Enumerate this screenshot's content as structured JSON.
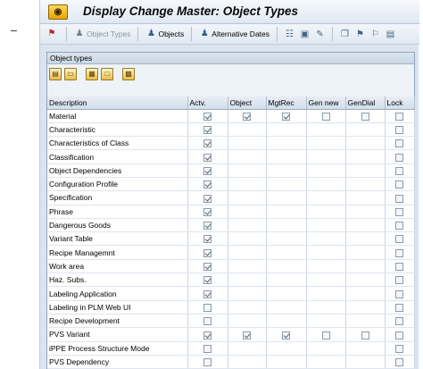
{
  "window": {
    "title": "Display Change Master: Object Types",
    "app_icon": "glasses-icon"
  },
  "toolbar": {
    "object_types_label": "Object Types",
    "objects_label": "Objects",
    "alternative_dates_label": "Alternative Dates"
  },
  "panel": {
    "title": "Object types"
  },
  "table": {
    "columns": [
      "Description",
      "Actv.",
      "Object",
      "MgtRec",
      "Gen new",
      "GenDial",
      "Lock"
    ],
    "rows": [
      {
        "description": "Material",
        "actv": true,
        "object": true,
        "mgtrec": true,
        "gennew": false,
        "gendial": false,
        "lock": false
      },
      {
        "description": "Characteristic",
        "actv": true,
        "object": null,
        "mgtrec": null,
        "gennew": null,
        "gendial": null,
        "lock": false
      },
      {
        "description": "Characteristics of Class",
        "actv": true,
        "object": null,
        "mgtrec": null,
        "gennew": null,
        "gendial": null,
        "lock": false
      },
      {
        "description": "Classification",
        "actv": true,
        "object": null,
        "mgtrec": null,
        "gennew": null,
        "gendial": null,
        "lock": false
      },
      {
        "description": "Object Dependencies",
        "actv": true,
        "object": null,
        "mgtrec": null,
        "gennew": null,
        "gendial": null,
        "lock": false
      },
      {
        "description": "Configuration Profile",
        "actv": true,
        "object": null,
        "mgtrec": null,
        "gennew": null,
        "gendial": null,
        "lock": false
      },
      {
        "description": "Specification",
        "actv": true,
        "object": null,
        "mgtrec": null,
        "gennew": null,
        "gendial": null,
        "lock": false
      },
      {
        "description": "Phrase",
        "actv": true,
        "object": null,
        "mgtrec": null,
        "gennew": null,
        "gendial": null,
        "lock": false
      },
      {
        "description": "Dangerous Goods",
        "actv": true,
        "object": null,
        "mgtrec": null,
        "gennew": null,
        "gendial": null,
        "lock": false
      },
      {
        "description": "Variant Table",
        "actv": true,
        "object": null,
        "mgtrec": null,
        "gennew": null,
        "gendial": null,
        "lock": false
      },
      {
        "description": "Recipe Managemnt",
        "actv": true,
        "object": null,
        "mgtrec": null,
        "gennew": null,
        "gendial": null,
        "lock": false
      },
      {
        "description": "Work area",
        "actv": true,
        "object": null,
        "mgtrec": null,
        "gennew": null,
        "gendial": null,
        "lock": false
      },
      {
        "description": "Haz. Subs.",
        "actv": true,
        "object": null,
        "mgtrec": null,
        "gennew": null,
        "gendial": null,
        "lock": false
      },
      {
        "description": "Labeling Application",
        "actv": true,
        "object": null,
        "mgtrec": null,
        "gennew": null,
        "gendial": null,
        "lock": false
      },
      {
        "description": "Labeling in PLM Web UI",
        "actv": false,
        "object": null,
        "mgtrec": null,
        "gennew": null,
        "gendial": null,
        "lock": false
      },
      {
        "description": "Recipe Development",
        "actv": false,
        "object": null,
        "mgtrec": null,
        "gennew": null,
        "gendial": null,
        "lock": false
      },
      {
        "description": "PVS Variant",
        "actv": true,
        "object": true,
        "mgtrec": true,
        "gennew": false,
        "gendial": false,
        "lock": false
      },
      {
        "description": "iPPE Process Structure Mode",
        "actv": false,
        "object": null,
        "mgtrec": null,
        "gennew": null,
        "gendial": null,
        "lock": false
      },
      {
        "description": "PVS Dependency",
        "actv": false,
        "object": null,
        "mgtrec": null,
        "gennew": null,
        "gendial": null,
        "lock": false
      }
    ]
  }
}
